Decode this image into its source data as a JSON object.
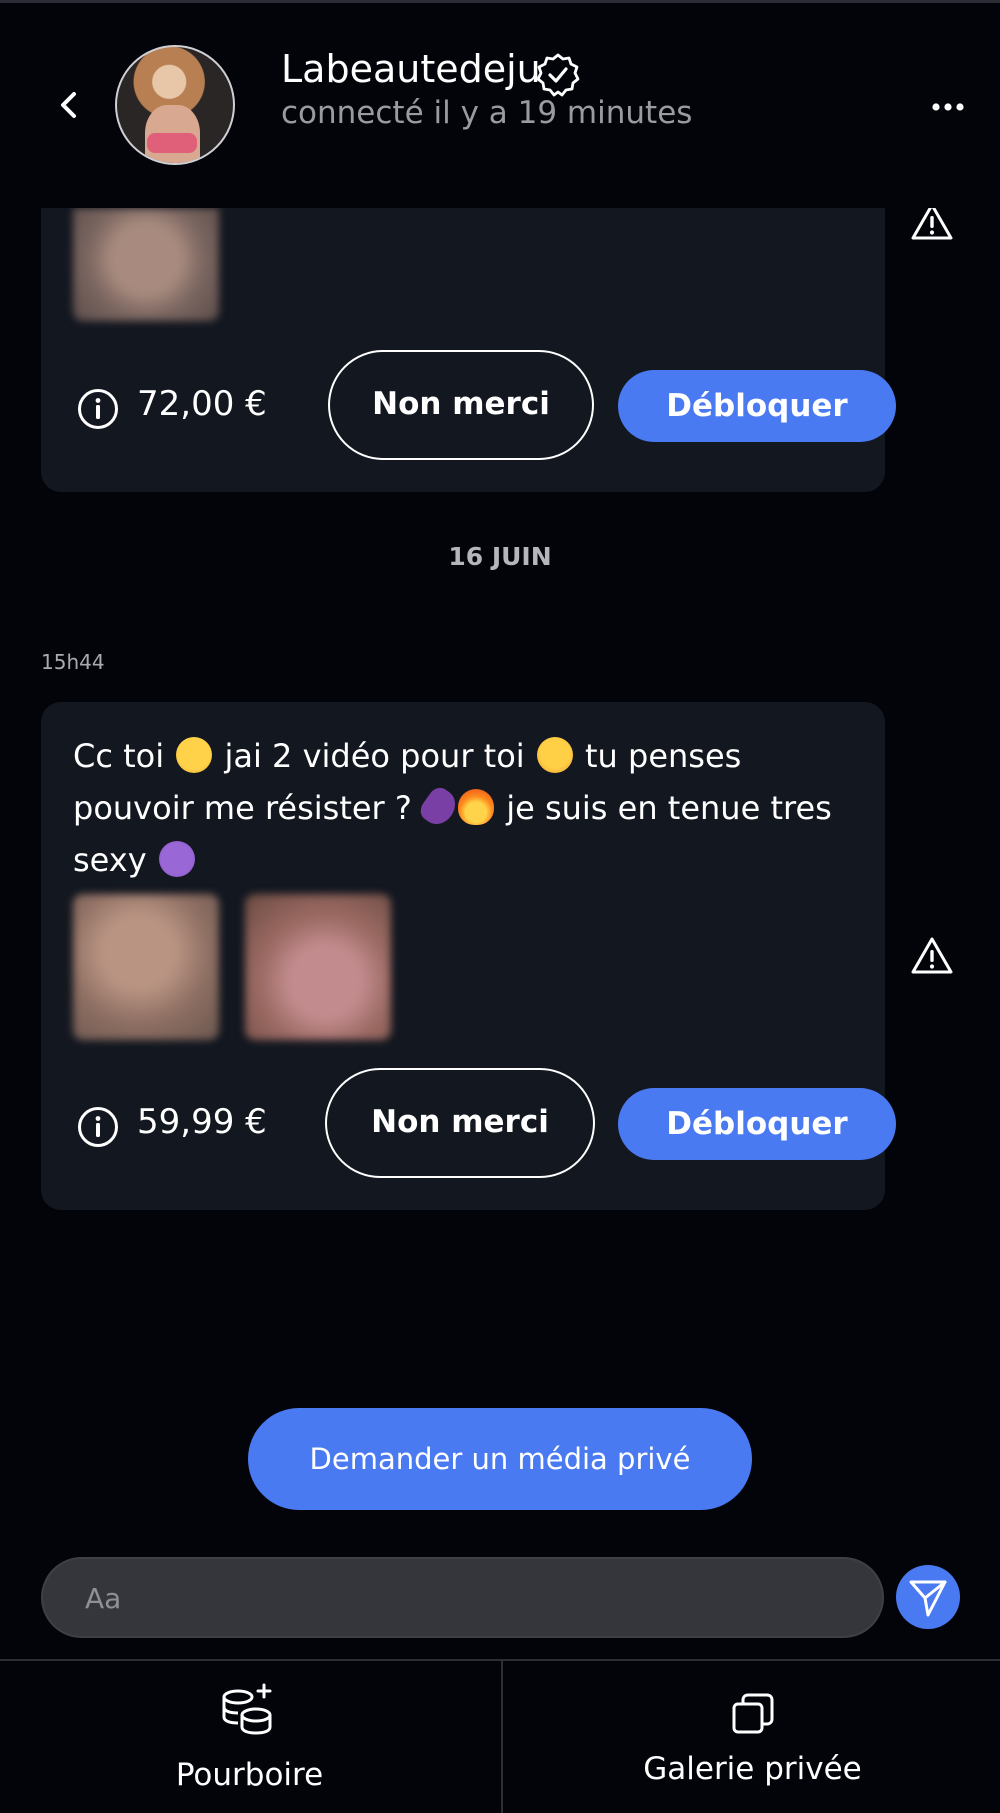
{
  "header": {
    "back_icon": "chevron-left-icon",
    "name": "Labeautedeju",
    "verified_icon": "verified-badge-icon",
    "status": "connecté il y a 19 minutes",
    "more_icon": "more-horizontal-icon"
  },
  "messages": [
    {
      "price": "72,00 €",
      "decline_label": "Non merci",
      "unlock_label": "Débloquer"
    },
    {
      "time": "15h44",
      "text": "Cc toi 😊 jai 2 vidéo pour toi 🤭 tu penses pouvoir me résister ? 🍆🔥 je suis en tenue tres sexy 😈",
      "text_parts": [
        "Cc toi ",
        " jai 2 vidéo pour toi ",
        " tu penses pouvoir me résister ? ",
        " je suis en tenue tres sexy "
      ],
      "price": "59,99 €",
      "decline_label": "Non merci",
      "unlock_label": "Débloquer"
    }
  ],
  "date_separator": "16 JUIN",
  "request_button": "Demander un média privé",
  "composer": {
    "placeholder": "Aa"
  },
  "tabs": [
    {
      "label": "Pourboire",
      "icon": "coins-plus-icon"
    },
    {
      "label": "Galerie privée",
      "icon": "gallery-copy-icon"
    }
  ],
  "colors": {
    "accent": "#4a7af2",
    "background": "#03040a",
    "card": "#131720"
  }
}
